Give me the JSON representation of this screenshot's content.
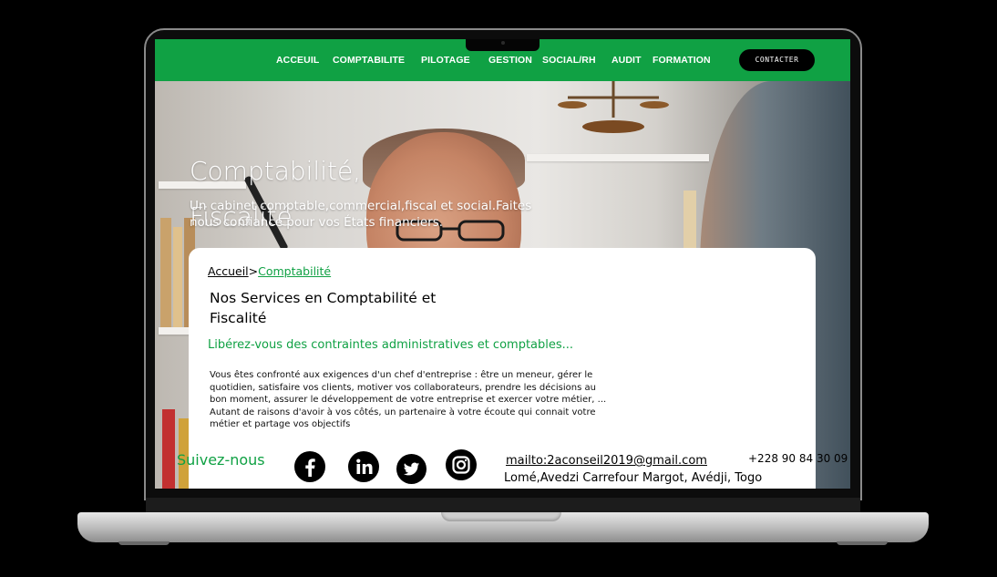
{
  "nav": {
    "items": [
      {
        "label": "ACCEUIL"
      },
      {
        "label": "COMPTABILITE"
      },
      {
        "label": "PILOTAGE"
      },
      {
        "label": "GESTION"
      },
      {
        "label": "SOCIAL/RH"
      },
      {
        "label": "AUDIT"
      },
      {
        "label": "FORMATION"
      }
    ],
    "contact_label": "CONTACTER"
  },
  "hero": {
    "title_line1": "Comptabilité,",
    "title_line2": "Fiscalité",
    "subtitle": "Un cabinet comptable,commercial,fiscal et social.Faites nous confiance pour vos États financiers."
  },
  "breadcrumb": {
    "home": "Accueil",
    "separator": ">",
    "current": "Comptabilité"
  },
  "content": {
    "heading": "Nos Services en Comptabilité et Fiscalité",
    "lead": "Libérez-vous des contraintes administratives et comptables...",
    "paragraph1": "Vous êtes confronté aux exigences d'un chef d'entreprise : être un meneur, gérer le quotidien, satisfaire vos clients, motiver vos collaborateurs, prendre les décisions au bon moment, assurer le développement de votre entreprise et exercer votre métier, ...",
    "paragraph2": "Autant de raisons d'avoir à vos côtés, un partenaire à votre écoute qui connait votre métier et partage vos objectifs"
  },
  "footer": {
    "follow_label": "Suivez-nous",
    "social": [
      {
        "icon": "facebook-icon"
      },
      {
        "icon": "linkedin-icon"
      },
      {
        "icon": "twitter-icon"
      },
      {
        "icon": "instagram-icon"
      }
    ],
    "email": "mailto:2aconseil2019@gmail.com",
    "address": "Lomé,Avedzi Carrefour Margot, Avédji, Togo",
    "phone": "+228 90 84 30 09"
  },
  "colors": {
    "brand_green": "#10a144",
    "nav_text": "#ffffff"
  }
}
